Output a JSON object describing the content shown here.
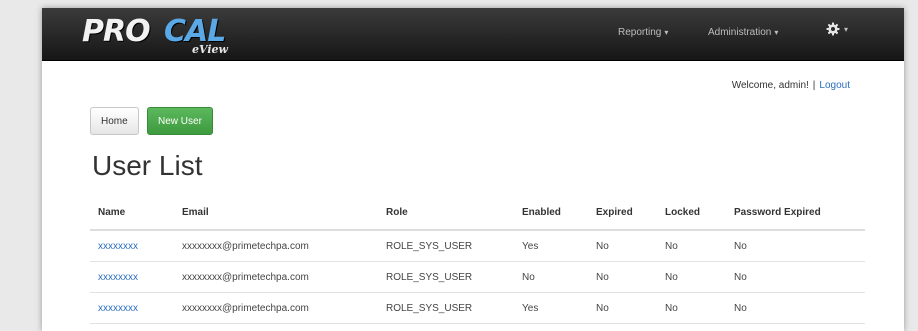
{
  "brand": {
    "logo_pro": "PRO",
    "logo_cal": "CAL",
    "logo_sub": "eView"
  },
  "nav": {
    "reporting": "Reporting",
    "administration": "Administration",
    "settings_icon": "gear-icon"
  },
  "header": {
    "welcome": "Welcome, admin!",
    "separator": "|",
    "logout": "Logout"
  },
  "buttons": {
    "home": "Home",
    "new_user": "New User"
  },
  "page_title": "User List",
  "table": {
    "columns": [
      "Name",
      "Email",
      "Role",
      "Enabled",
      "Expired",
      "Locked",
      "Password Expired"
    ],
    "rows": [
      [
        "xxxxxxxx",
        "xxxxxxxx@primetechpa.com",
        "ROLE_SYS_USER",
        "Yes",
        "No",
        "No",
        "No"
      ],
      [
        "xxxxxxxx",
        "xxxxxxxx@primetechpa.com",
        "ROLE_SYS_USER",
        "No",
        "No",
        "No",
        "No"
      ],
      [
        "xxxxxxxx",
        "xxxxxxxx@primetechpa.com",
        "ROLE_SYS_USER",
        "Yes",
        "No",
        "No",
        "No"
      ]
    ]
  },
  "colors": {
    "navbar": "#1f1f1f",
    "link": "#2a6ebb",
    "success": "#4cae4c"
  }
}
